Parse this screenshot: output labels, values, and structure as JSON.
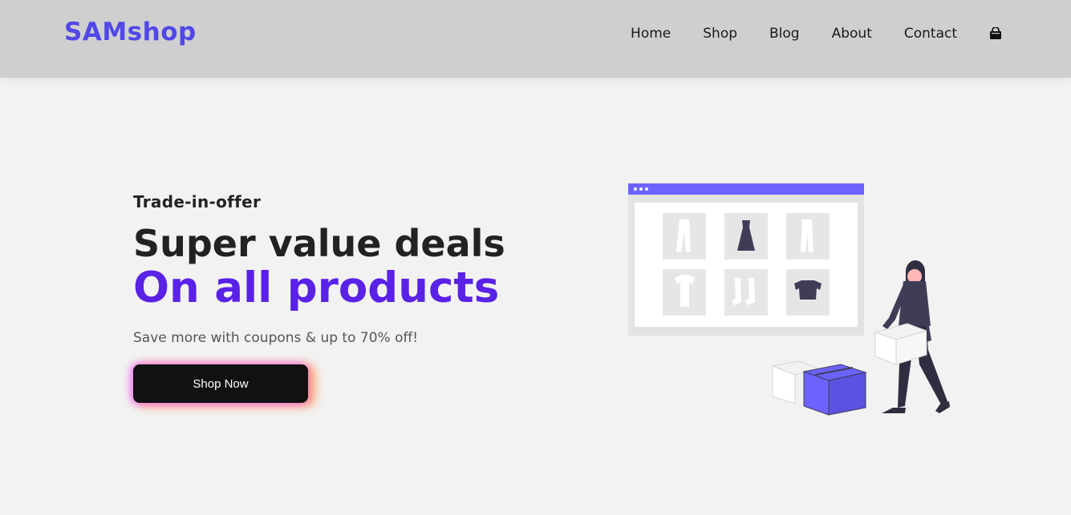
{
  "header": {
    "logo": "SAMshop",
    "nav": [
      "Home",
      "Shop",
      "Blog",
      "About",
      "Contact"
    ],
    "cart_icon": "shopping-bag-icon"
  },
  "hero": {
    "eyebrow": "Trade-in-offer",
    "headline": "Super value deals",
    "headline_accent": "On all products",
    "subtitle": "Save more with coupons & up to 70% off!",
    "button": "Shop Now"
  },
  "colors": {
    "brand": "#5147e8",
    "accent": "#5a21e6",
    "header_bg": "#cfcfcf",
    "page_bg": "#f2f2f2",
    "button_bg": "#111111"
  }
}
